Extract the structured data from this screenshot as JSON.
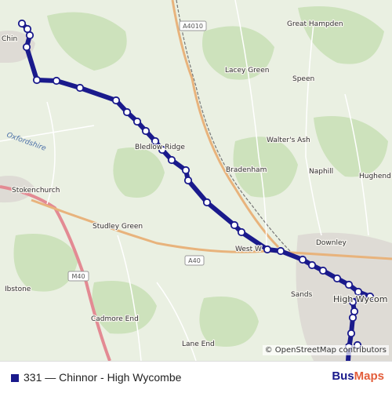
{
  "map": {
    "places": [
      {
        "id": "chinnor",
        "label": "Chin"
      },
      {
        "id": "great-hampden",
        "label": "Great Hampden"
      },
      {
        "id": "lacey-green",
        "label": "Lacey Green"
      },
      {
        "id": "speen",
        "label": "Speen"
      },
      {
        "id": "oxfordshire",
        "label": "Oxfordshire"
      },
      {
        "id": "bledlow-ridge",
        "label": "Bledlow Ridge"
      },
      {
        "id": "walters-ash",
        "label": "Walter's Ash"
      },
      {
        "id": "bradenham",
        "label": "Bradenham"
      },
      {
        "id": "naphill",
        "label": "Naphill"
      },
      {
        "id": "hughenden-valley",
        "label": "Hughend Valley"
      },
      {
        "id": "stokenchurch",
        "label": "Stokenchurch"
      },
      {
        "id": "studley-green",
        "label": "Studley Green"
      },
      {
        "id": "downley",
        "label": "Downley"
      },
      {
        "id": "west-wycombe",
        "label": "West W"
      },
      {
        "id": "ibstone",
        "label": "Ibstone"
      },
      {
        "id": "sands",
        "label": "Sands"
      },
      {
        "id": "high-wycombe",
        "label": "High Wycom"
      },
      {
        "id": "cadmore-end",
        "label": "Cadmore End"
      },
      {
        "id": "lane-end",
        "label": "Lane End"
      }
    ],
    "roads": [
      {
        "id": "a4010",
        "label": "A4010"
      },
      {
        "id": "a40",
        "label": "A40"
      },
      {
        "id": "m40",
        "label": "M40"
      }
    ],
    "attribution": "© OpenStreetMap contributors",
    "colors": {
      "route": "#1a1a8c",
      "stop_fill": "#ffffff",
      "motorway": "#e38a93",
      "primary": "#e8b37c",
      "land": "#e9efe1",
      "wood": "#cfe3bf"
    }
  },
  "footer": {
    "route_label": "331 — Chinnor - High Wycombe",
    "route_color": "#1a1a8c",
    "brand_part1": "Bus",
    "brand_part2": "Maps"
  }
}
